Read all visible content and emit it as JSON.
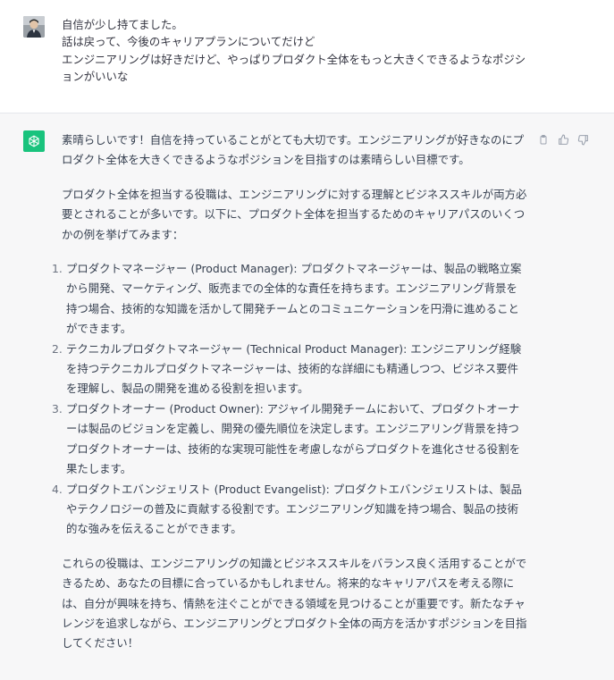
{
  "user_message": {
    "avatar_icon": "user-photo-icon",
    "text": "自信が少し持てました。\n話は戻って、今後のキャリアプランについてだけど\nエンジニアリングは好きだけど、やっぱりプロダクト全体をもっと大きくできるようなポジションがいいな"
  },
  "assistant_message": {
    "avatar_icon": "chatgpt-logo-icon",
    "accent_color": "#19c37d",
    "paragraph_1": "素晴らしいです！自信を持っていることがとても大切です。エンジニアリングが好きなのにプロダクト全体を大きくできるようなポジションを目指すのは素晴らしい目標です。",
    "paragraph_2": "プロダクト全体を担当する役職は、エンジニアリングに対する理解とビジネススキルが両方必要とされることが多いです。以下に、プロダクト全体を担当するためのキャリアパスのいくつかの例を挙げてみます：",
    "list": [
      {
        "num": "1.",
        "text": "プロダクトマネージャー (Product Manager): プロダクトマネージャーは、製品の戦略立案から開発、マーケティング、販売までの全体的な責任を持ちます。エンジニアリング背景を持つ場合、技術的な知識を活かして開発チームとのコミュニケーションを円滑に進めることができます。"
      },
      {
        "num": "2.",
        "text": "テクニカルプロダクトマネージャー (Technical Product Manager): エンジニアリング経験を持つテクニカルプロダクトマネージャーは、技術的な詳細にも精通しつつ、ビジネス要件を理解し、製品の開発を進める役割を担います。"
      },
      {
        "num": "3.",
        "text": "プロダクトオーナー (Product Owner): アジャイル開発チームにおいて、プロダクトオーナーは製品のビジョンを定義し、開発の優先順位を決定します。エンジニアリング背景を持つプロダクトオーナーは、技術的な実現可能性を考慮しながらプロダクトを進化させる役割を果たします。"
      },
      {
        "num": "4.",
        "text": "プロダクトエバンジェリスト (Product Evangelist): プロダクトエバンジェリストは、製品やテクノロジーの普及に貢献する役割です。エンジニアリング知識を持つ場合、製品の技術的な強みを伝えることができます。"
      }
    ],
    "paragraph_3": "これらの役職は、エンジニアリングの知識とビジネススキルをバランス良く活用することができるため、あなたの目標に合っているかもしれません。将来的なキャリアパスを考える際には、自分が興味を持ち、情熱を注ぐことができる領域を見つけることが重要です。新たなチャレンジを追求しながら、エンジニアリングとプロダクト全体の両方を活かすポジションを目指してください！",
    "actions": {
      "copy_icon": "clipboard-icon",
      "like_icon": "thumbs-up-icon",
      "dislike_icon": "thumbs-down-icon"
    }
  }
}
